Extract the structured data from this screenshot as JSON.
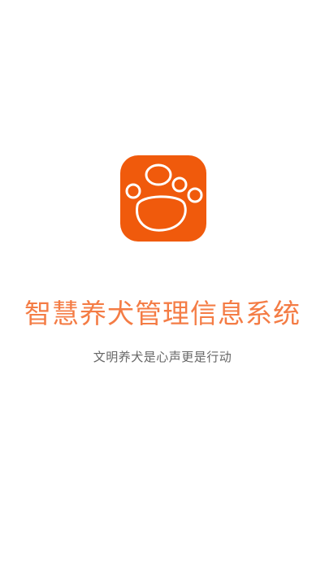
{
  "splash": {
    "icon": "paw-print-icon",
    "title": "智慧养犬管理信息系统",
    "slogan": "文明养犬是心声更是行动"
  },
  "colors": {
    "brand": "#f05a0c",
    "title": "#f47c45",
    "slogan": "#666666",
    "background": "#ffffff",
    "icon_stroke": "#ffffff"
  }
}
